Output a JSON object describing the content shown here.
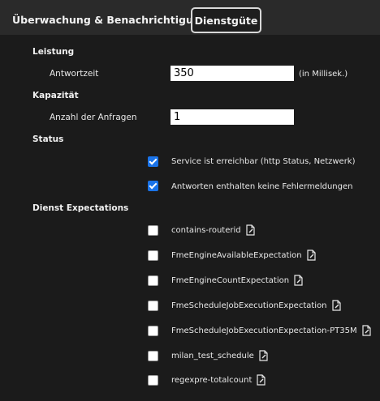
{
  "tabs": [
    {
      "label": "Überwachung & Benachrichtigung",
      "active": false
    },
    {
      "label": "Dienstgüte",
      "active": true
    }
  ],
  "leistung": {
    "title": "Leistung",
    "antwortzeit_label": "Antwortzeit",
    "antwortzeit_value": "350",
    "unit": "(in Millisek.)"
  },
  "kapazitaet": {
    "title": "Kapazität",
    "anfragen_label": "Anzahl der Anfragen",
    "anfragen_value": "1"
  },
  "status": {
    "title": "Status",
    "items": [
      {
        "label": "Service ist erreichbar (http Status, Netzwerk)",
        "checked": true
      },
      {
        "label": "Antworten enthalten keine Fehlermeldungen",
        "checked": true
      }
    ]
  },
  "expectations": {
    "title": "Dienst Expectations",
    "items": [
      {
        "label": "contains-routerid",
        "checked": false
      },
      {
        "label": "FmeEngineAvailableExpectation",
        "checked": false
      },
      {
        "label": "FmeEngineCountExpectation",
        "checked": false
      },
      {
        "label": "FmeScheduleJobExecutionExpectation",
        "checked": false
      },
      {
        "label": "FmeScheduleJobExecutionExpectation-PT35M",
        "checked": false
      },
      {
        "label": "milan_test_schedule",
        "checked": false
      },
      {
        "label": "regexpre-totalcount",
        "checked": false
      }
    ]
  },
  "icons": {
    "edit": "edit-document-icon"
  },
  "colors": {
    "accent": "#1a73e8",
    "background": "#1b1b1b",
    "tabbar": "#2a2a2a"
  }
}
